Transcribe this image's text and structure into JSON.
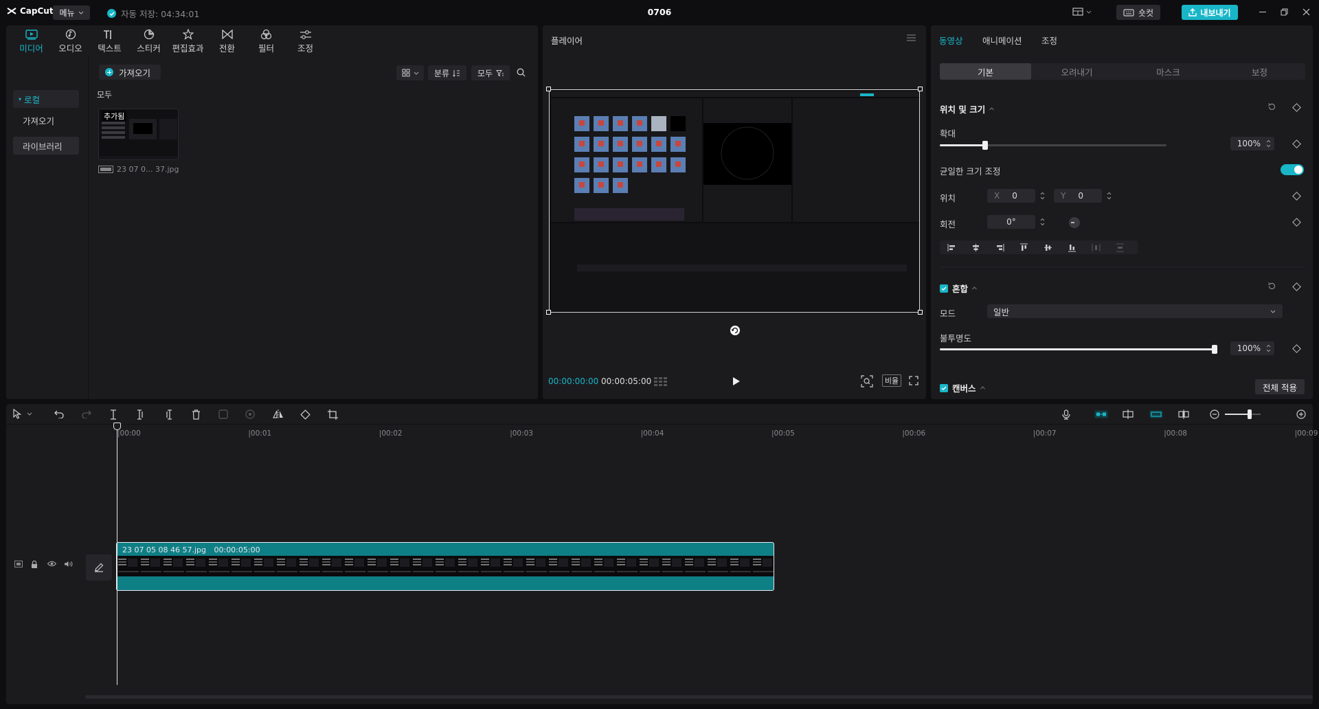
{
  "app": {
    "logo_text": "CapCut",
    "menu_label": "메뉴",
    "autosave_text": "자동 저장: 04:34:01",
    "project_title": "0706",
    "shortcut_label": "숏컷",
    "export_label": "내보내기"
  },
  "media": {
    "tabs": [
      {
        "label": "미디어",
        "icon": "media-icon"
      },
      {
        "label": "오디오",
        "icon": "audio-icon"
      },
      {
        "label": "텍스트",
        "icon": "text-icon"
      },
      {
        "label": "스티커",
        "icon": "sticker-icon"
      },
      {
        "label": "편집효과",
        "icon": "effects-icon"
      },
      {
        "label": "전환",
        "icon": "transition-icon"
      },
      {
        "label": "필터",
        "icon": "filter-icon"
      },
      {
        "label": "조정",
        "icon": "adjust-icon"
      }
    ],
    "side": {
      "local": "로컬",
      "import": "가져오기",
      "library": "라이브러리"
    },
    "import_button": "가져오기",
    "sort_label": "분류",
    "filter_label": "모두",
    "section_all": "모두",
    "item": {
      "badge": "추가됨",
      "name": "23 07 0... 37.jpg"
    }
  },
  "player": {
    "title": "플레이어",
    "current_time": "00:00:00:00",
    "total_time": "00:00:05:00",
    "ratio_label": "비율"
  },
  "inspector": {
    "tabs": [
      "동영상",
      "애니메이션",
      "조정"
    ],
    "subtabs": [
      "기본",
      "오려내기",
      "마스크",
      "보정"
    ],
    "position_size": "위치 및 크기",
    "scale_label": "확대",
    "scale_value": "100%",
    "scale_fraction": 0.2,
    "uniform_label": "균일한 크기 조정",
    "position_label": "위치",
    "pos_x_label": "X",
    "pos_x": "0",
    "pos_y_label": "Y",
    "pos_y": "0",
    "rotation_label": "회전",
    "rotation_value": "0°",
    "blend_label": "혼합",
    "mode_label": "모드",
    "mode_value": "일반",
    "opacity_label": "불투명도",
    "opacity_value": "100%",
    "opacity_fraction": 1.0,
    "canvas_label": "캔버스",
    "apply_all": "전체 적용"
  },
  "timeline": {
    "ruler": [
      "00:00",
      "00:01",
      "00:02",
      "00:03",
      "00:04",
      "00:05",
      "00:06",
      "00:07",
      "00:08",
      "00:09"
    ],
    "clip": {
      "name": "23 07 05 08 46 57.jpg",
      "duration": "00:00:05:00"
    }
  },
  "colors": {
    "accent": "#19b6c8",
    "panel": "#1b1b1e",
    "clip": "#0f7f86"
  }
}
